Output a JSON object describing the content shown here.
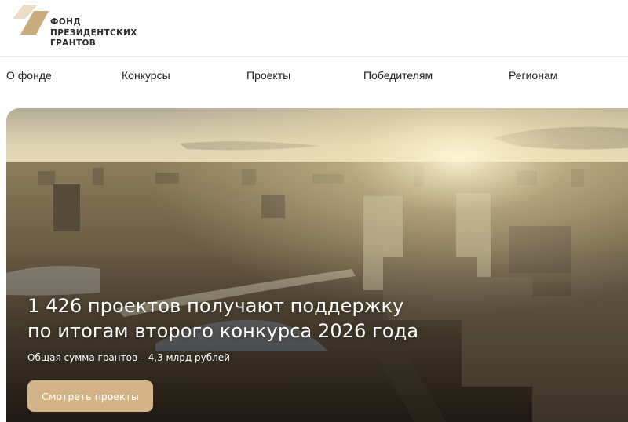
{
  "header": {
    "logo_icon": "fund-logo-icon",
    "logo_lines": [
      "Фонд",
      "президентских",
      "грантов"
    ]
  },
  "nav": {
    "items": [
      {
        "label": "О фонде"
      },
      {
        "label": "Конкурсы"
      },
      {
        "label": "Проекты"
      },
      {
        "label": "Победителям"
      },
      {
        "label": "Регионам"
      }
    ]
  },
  "hero": {
    "image": "city-aerial-sunset-photo",
    "title_line1": "1 426 проектов получают поддержку",
    "title_line2": "по итогам второго конкурса 2026 года",
    "subtitle": "Общая сумма грантов – 4,3 млрд рублей",
    "button_label": "Смотреть проекты"
  },
  "colors": {
    "accent": "#d4b486",
    "logo_gold": "#c9ab7e",
    "text": "#1f1f1f"
  }
}
